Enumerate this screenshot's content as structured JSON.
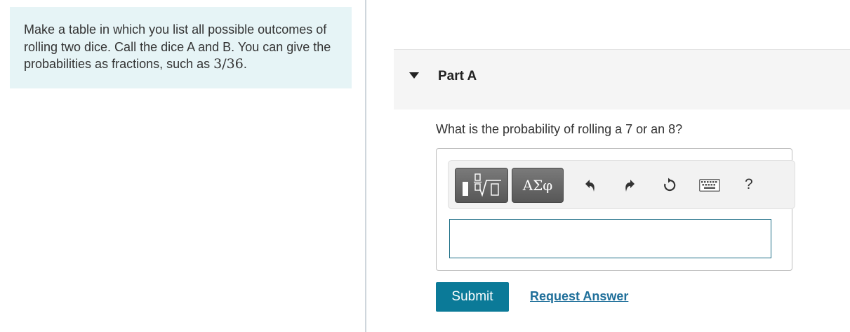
{
  "intro": {
    "text": "Make a table in which you list all possible outcomes of rolling two dice. Call the dice A and B. You can give the probabilities as fractions, such as ",
    "math": "3/36",
    "suffix": "."
  },
  "part": {
    "title": "Part A",
    "question": "What is the probability of rolling a 7 or an 8?"
  },
  "toolbar": {
    "templates_icon": "templates-sqrt-icon",
    "greek_label": "ΑΣφ",
    "undo_icon": "undo-icon",
    "redo_icon": "redo-icon",
    "reset_icon": "reset-icon",
    "keyboard_icon": "keyboard-icon",
    "help_label": "?"
  },
  "answer": {
    "value": ""
  },
  "actions": {
    "submit_label": "Submit",
    "request_label": "Request Answer"
  }
}
